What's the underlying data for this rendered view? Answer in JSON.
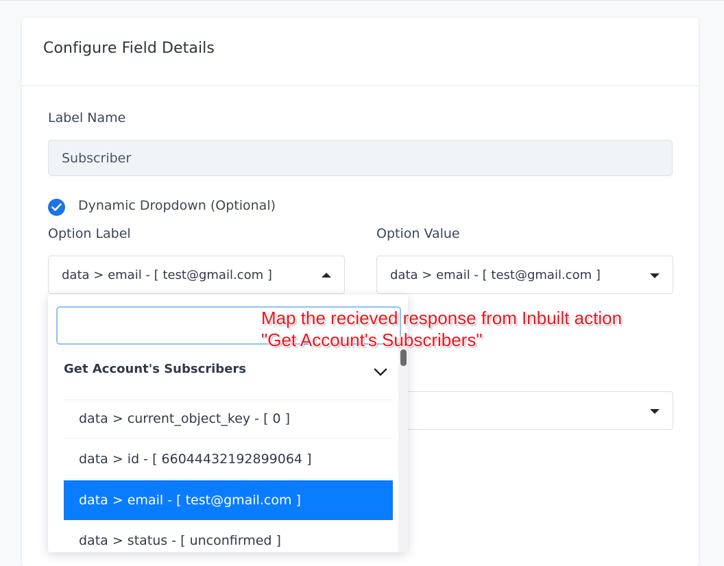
{
  "card": {
    "title": "Configure Field Details"
  },
  "label_name": {
    "label": "Label Name",
    "value": "Subscriber"
  },
  "dynamic_dropdown": {
    "label": "Dynamic Dropdown (Optional)",
    "checked": true,
    "check_color": "#1a73e8"
  },
  "option_label": {
    "label": "Option Label",
    "selected": "data > email - [ test@gmail.com ]",
    "open": true
  },
  "option_value": {
    "label": "Option Value",
    "selected": "data > email - [ test@gmail.com ]"
  },
  "dropdown": {
    "search_value": "",
    "group": {
      "title": "Get Account's Subscribers",
      "chevron": "chevron-down-icon"
    },
    "options": [
      {
        "label": "data > current_object_key - [ 0 ]",
        "selected": false
      },
      {
        "label": "data > id - [ 66044432192899064 ]",
        "selected": false
      },
      {
        "label": "data > email - [ test@gmail.com ]",
        "selected": true
      },
      {
        "label": "data > status - [ unconfirmed ]",
        "selected": false
      }
    ],
    "highlight_color": "#0a7cff"
  },
  "annotation": {
    "line1": "Map the recieved response from Inbuilt action",
    "line2": "\"Get Account's Subscribers\"",
    "color": "#e8141e"
  }
}
